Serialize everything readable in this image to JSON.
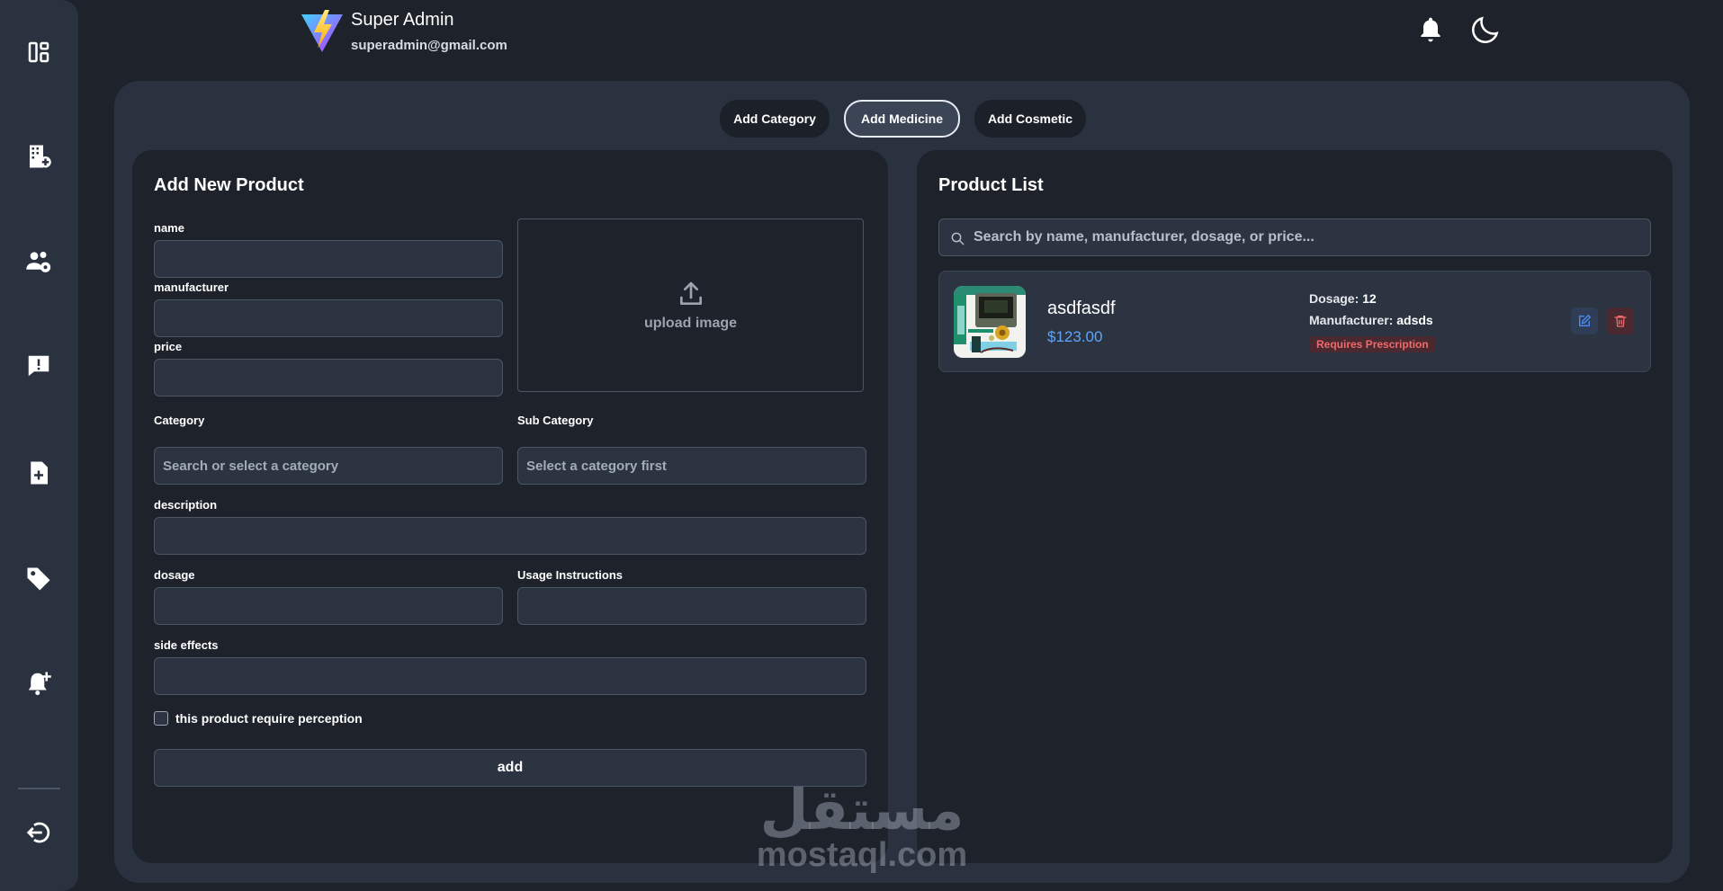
{
  "header": {
    "user_name": "Super Admin",
    "user_email": "superadmin@gmail.com"
  },
  "sidebar": {
    "items": [
      {
        "icon": "dashboard-icon"
      },
      {
        "icon": "pharmacy-building-icon"
      },
      {
        "icon": "users-settings-icon"
      },
      {
        "icon": "message-alert-icon"
      },
      {
        "icon": "add-document-icon"
      },
      {
        "icon": "tag-icon"
      },
      {
        "icon": "add-notification-icon"
      },
      {
        "icon": "logout-icon"
      }
    ]
  },
  "tabs": [
    {
      "label": "Add Category",
      "active": false
    },
    {
      "label": "Add Medicine",
      "active": true
    },
    {
      "label": "Add Cosmetic",
      "active": false
    }
  ],
  "form": {
    "title": "Add New Product",
    "name_label": "name",
    "manufacturer_label": "manufacturer",
    "price_label": "price",
    "upload_label": "upload image",
    "category_label": "Category",
    "category_placeholder": "Search or select a category",
    "subcategory_label": "Sub Category",
    "subcategory_placeholder": "Select a category first",
    "description_label": "description",
    "dosage_label": "dosage",
    "usage_label": "Usage Instructions",
    "side_effects_label": "side effects",
    "prescription_checkbox_label": "this product require perception",
    "submit_label": "add"
  },
  "product_list": {
    "title": "Product List",
    "search_placeholder": "Search by name, manufacturer, dosage, or price...",
    "items": [
      {
        "name": "asdfasdf",
        "price": "$123.00",
        "dosage_key": "Dosage:",
        "dosage": "12",
        "manufacturer_key": "Manufacturer:",
        "manufacturer": "adsds",
        "badge": "Requires Prescription"
      }
    ]
  },
  "watermark": {
    "arabic": "مستقل",
    "latin": "mostaql.com"
  },
  "colors": {
    "background": "#1d222b",
    "panel": "#2a3240",
    "accent_price": "#60a5fa",
    "danger": "#ef6a6a"
  }
}
